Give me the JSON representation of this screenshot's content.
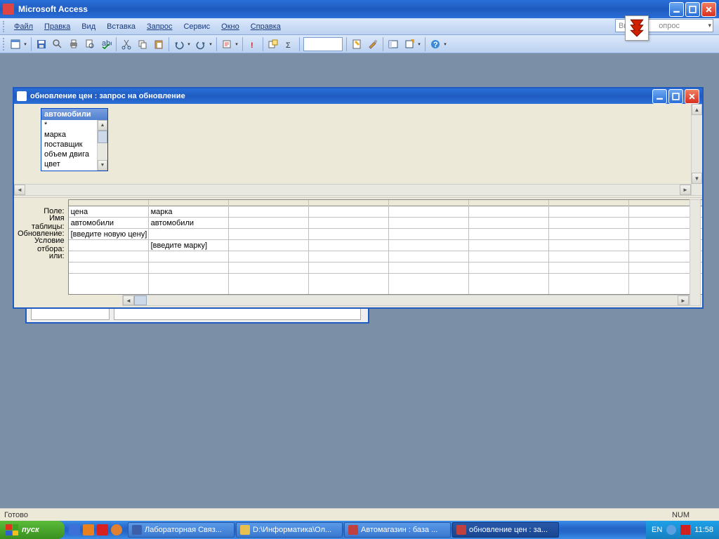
{
  "app": {
    "title": "Microsoft Access"
  },
  "menu": {
    "file": "Файл",
    "edit": "Правка",
    "view": "Вид",
    "insert": "Вставка",
    "query": "Запрос",
    "service": "Сервис",
    "window": "Окно",
    "help": "Справка"
  },
  "helpbox": {
    "placeholder_left": "Вве",
    "placeholder_right": "опрос"
  },
  "childwin": {
    "title": "обновление цен : запрос на обновление"
  },
  "tablebox": {
    "name": "автомобили",
    "fields": [
      "*",
      "марка",
      "поставщик",
      "объем двига",
      "цвет"
    ]
  },
  "grid": {
    "labels": {
      "field": "Поле:",
      "table": "Имя таблицы:",
      "update": "Обновление:",
      "criteria": "Условие отбора:",
      "or": "или:"
    },
    "cols": [
      {
        "field": "цена",
        "table": "автомобили",
        "update": "[введите новую цену]",
        "criteria": "",
        "or": ""
      },
      {
        "field": "марка",
        "table": "автомобили",
        "update": "",
        "criteria": "[введите марку]",
        "or": ""
      },
      {
        "field": "",
        "table": "",
        "update": "",
        "criteria": "",
        "or": ""
      },
      {
        "field": "",
        "table": "",
        "update": "",
        "criteria": "",
        "or": ""
      },
      {
        "field": "",
        "table": "",
        "update": "",
        "criteria": "",
        "or": ""
      },
      {
        "field": "",
        "table": "",
        "update": "",
        "criteria": "",
        "or": ""
      },
      {
        "field": "",
        "table": "",
        "update": "",
        "criteria": "",
        "or": ""
      }
    ]
  },
  "status": {
    "ready": "Готово",
    "num": "NUM"
  },
  "taskbar": {
    "start": "пуск",
    "tasks": [
      {
        "label": "Лабораторная Связ...",
        "color": "#3b5fa8",
        "active": false
      },
      {
        "label": "D:\\Информатика\\Ол...",
        "color": "#e8c050",
        "active": false
      },
      {
        "label": "Автомагазин : база ...",
        "color": "#c04040",
        "active": false
      },
      {
        "label": "обновление цен : за...",
        "color": "#c04040",
        "active": true
      }
    ],
    "lang": "EN",
    "clock": "11:58"
  }
}
